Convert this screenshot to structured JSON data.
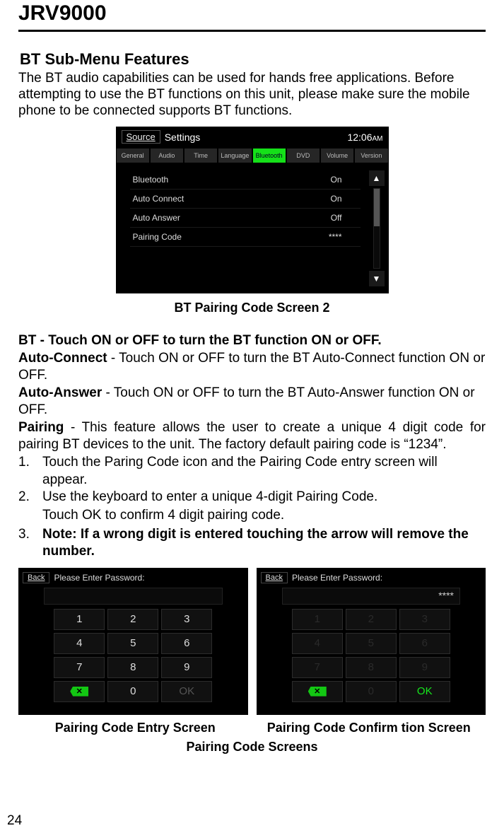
{
  "header": {
    "product": "JRV9000"
  },
  "section": {
    "title": "BT Sub-Menu Features",
    "intro": "The BT audio capabilities can be used for hands free applications. Before attempting to use the BT functions on this unit, please make sure the mobile phone to be connected supports BT functions."
  },
  "bt_screenshot": {
    "source_btn": "Source",
    "settings_label": "Settings",
    "clock": "12:06",
    "clock_suffix": "AM",
    "tabs": [
      "General",
      "Audio",
      "Time",
      "Language",
      "Bluetooth",
      "DVD",
      "Volume",
      "Version"
    ],
    "rows": [
      {
        "label": "Bluetooth",
        "value": "On"
      },
      {
        "label": "Auto Connect",
        "value": "On"
      },
      {
        "label": "Auto Answer",
        "value": "Off"
      },
      {
        "label": "Pairing Code",
        "value": "****"
      }
    ],
    "caption": "BT Pairing Code Screen 2"
  },
  "definitions": {
    "bt_line": "BT - Touch ON or OFF to turn the BT function ON or OFF.",
    "ac_label": "Auto-Connect",
    "ac_text": " - Touch ON or OFF to turn the BT Auto-Connect function ON or OFF.",
    "aa_label": "Auto-Answer",
    "aa_text": " - Touch ON or OFF to turn the BT Auto-Answer function ON or OFF.",
    "pair_label": "Pairing",
    "pair_text": " - This feature allows the user to create a unique 4 digit code for pairing  BT devices to the unit. The factory default pairing code is “1234”."
  },
  "steps": {
    "s1_num": "1.",
    "s1": "Touch the Paring Code icon and the Pairing Code entry screen will appear.",
    "s2_num": "2.",
    "s2": "Use the keyboard to enter a unique 4-digit Pairing Code.",
    "s2b": "Touch OK to confirm 4 digit pairing code.",
    "s3_num": "3.",
    "s3": "Note: If a wrong digit is entered touching the arrow will remove the number."
  },
  "keypads": {
    "back": "Back",
    "prompt": "Please Enter Password:",
    "confirm_value": "****",
    "keys": [
      "1",
      "2",
      "3",
      "4",
      "5",
      "6",
      "7",
      "8",
      "9",
      "x",
      "0",
      "OK"
    ],
    "entry_caption": "Pairing Code Entry Screen",
    "confirm_caption": "Pairing Code Confirm   tion Screen",
    "row_caption": "Pairing Code Screens"
  },
  "page_number": "24"
}
